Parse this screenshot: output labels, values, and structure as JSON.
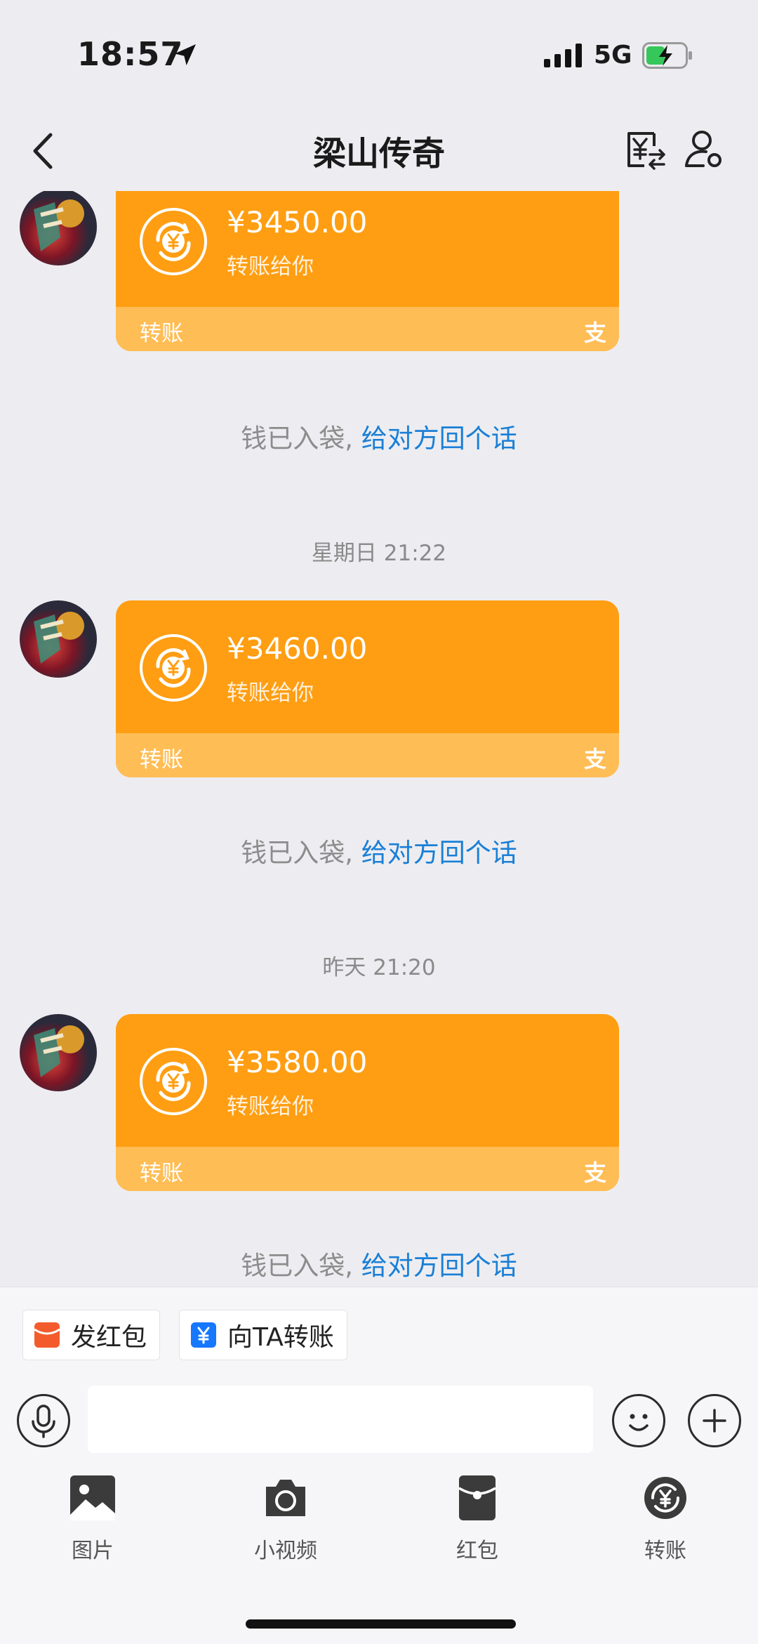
{
  "status_bar": {
    "time": "18:57",
    "network": "5G"
  },
  "nav": {
    "title": "梁山传奇"
  },
  "messages": [
    {
      "amount": "¥3450.00",
      "subtitle": "转账给你",
      "label": "转账",
      "logo": "支",
      "notice_prefix": "钱已入袋, ",
      "notice_link": "给对方回个话"
    },
    {
      "time": "星期日 21:22",
      "amount": "¥3460.00",
      "subtitle": "转账给你",
      "label": "转账",
      "logo": "支",
      "notice_prefix": "钱已入袋, ",
      "notice_link": "给对方回个话"
    },
    {
      "time": "昨天 21:20",
      "amount": "¥3580.00",
      "subtitle": "转账给你",
      "label": "转账",
      "logo": "支",
      "notice_prefix": "钱已入袋, ",
      "notice_link": "给对方回个话"
    }
  ],
  "quick_actions": {
    "red_packet": "发红包",
    "transfer": "向TA转账"
  },
  "input": {
    "placeholder": "",
    "value": ""
  },
  "tools": {
    "photo": "图片",
    "video": "小视频",
    "red_packet": "红包",
    "transfer": "转账"
  },
  "colors": {
    "card_orange": "#ff9e12",
    "card_footer": "#ffbd55",
    "link_blue": "#1a7fd6",
    "background": "#ededf1"
  },
  "icons": {
    "back": "chevron-left-icon",
    "transfer_switch": "yuan-transfer-icon",
    "profile": "user-settings-icon",
    "voice": "microphone-icon",
    "emoji": "smiley-icon",
    "more": "plus-icon"
  }
}
